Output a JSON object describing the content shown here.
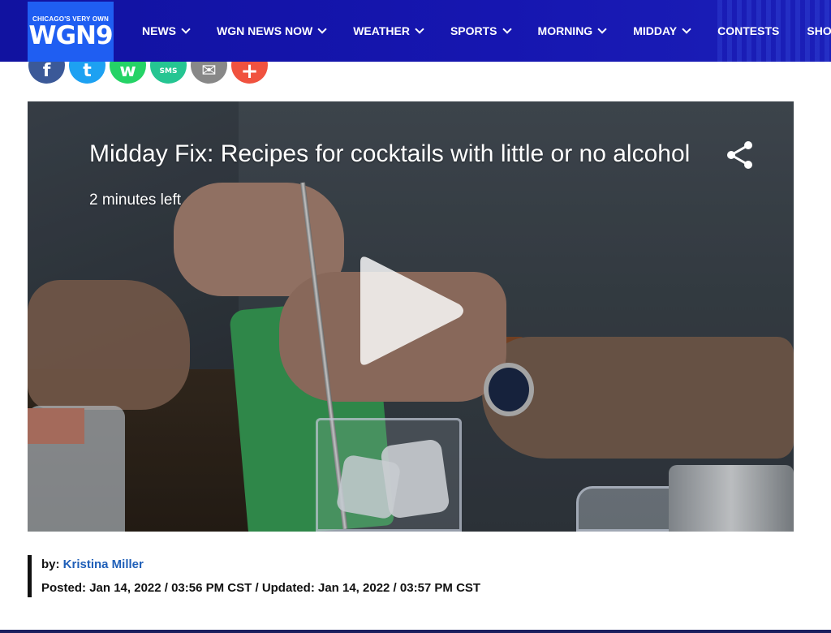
{
  "header": {
    "logo_tagline": "CHICAGO'S VERY OWN",
    "logo_mark": "WGN9",
    "nav": [
      {
        "label": "NEWS",
        "has_dropdown": true
      },
      {
        "label": "WGN NEWS NOW",
        "has_dropdown": true
      },
      {
        "label": "WEATHER",
        "has_dropdown": true
      },
      {
        "label": "SPORTS",
        "has_dropdown": true
      },
      {
        "label": "MORNING",
        "has_dropdown": true
      },
      {
        "label": "MIDDAY",
        "has_dropdown": true
      },
      {
        "label": "CONTESTS",
        "has_dropdown": false
      },
      {
        "label": "SHOWS",
        "has_dropdown": true
      }
    ]
  },
  "share": {
    "buttons": [
      {
        "name": "facebook",
        "glyph": "f",
        "color": "#3b5998"
      },
      {
        "name": "twitter",
        "glyph": "t",
        "color": "#1da1f2"
      },
      {
        "name": "whatsapp",
        "glyph": "w",
        "color": "#25d366"
      },
      {
        "name": "sms",
        "glyph": "SMS",
        "color": "#25c592"
      },
      {
        "name": "email",
        "glyph": "✉",
        "color": "#888888"
      },
      {
        "name": "more",
        "glyph": "+",
        "color": "#f0523f"
      }
    ]
  },
  "video": {
    "title": "Midday Fix: Recipes for cocktails with little or no alcohol",
    "time_left": "2 minutes left",
    "play_icon": "play-icon",
    "share_icon": "share-icon"
  },
  "byline": {
    "by_prefix": "by:",
    "author": "Kristina Miller",
    "posted_label": "Posted:",
    "posted_value": "Jan 14, 2022 / 03:56 PM CST",
    "separator": "/",
    "updated_label": "Updated:",
    "updated_value": "Jan 14, 2022 / 03:57 PM CST"
  },
  "colors": {
    "header_bg": "#1213a3",
    "logo_bg": "#1f5ef2",
    "author_link": "#1f5fb8"
  }
}
